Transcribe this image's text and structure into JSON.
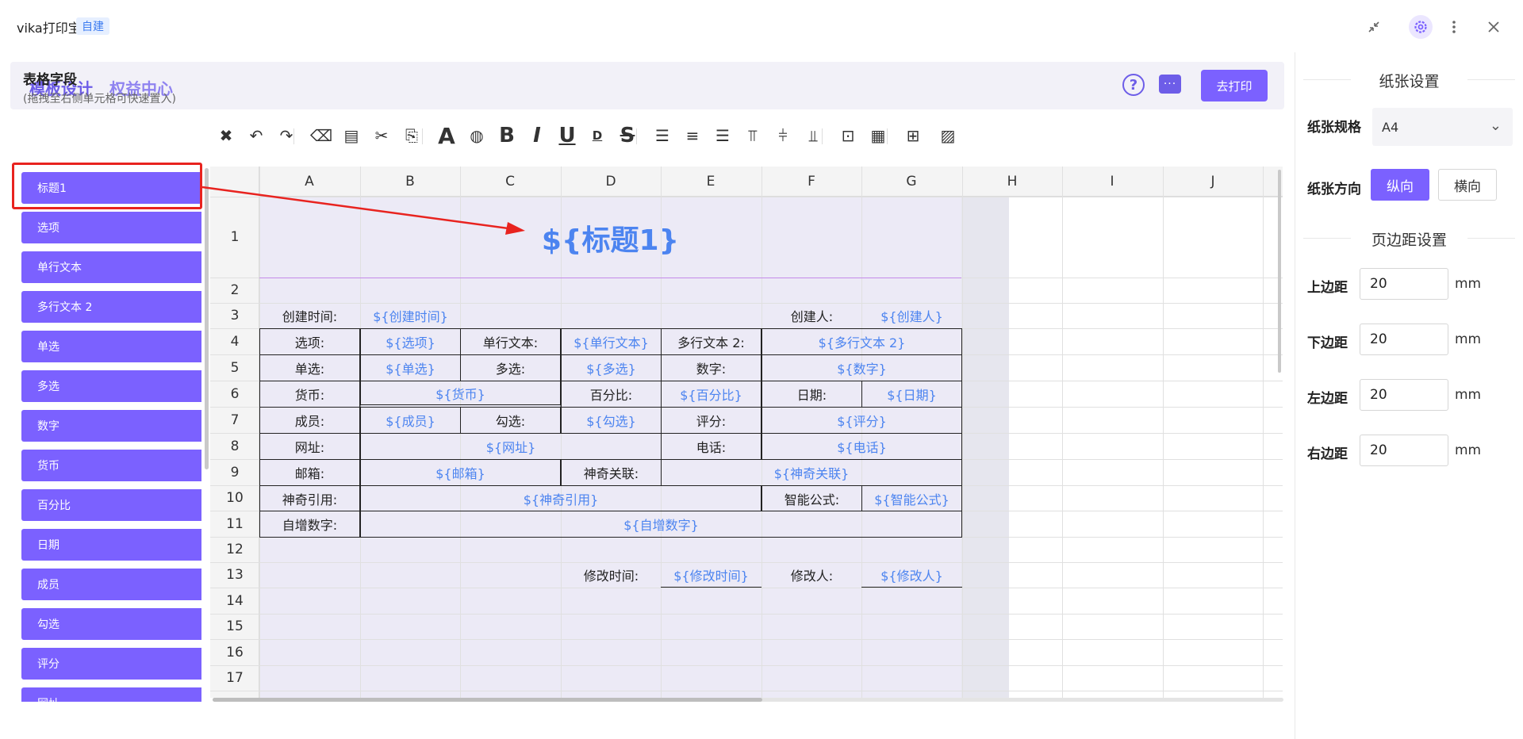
{
  "window": {
    "app_name": "vika打印宝",
    "app_badge": "自建"
  },
  "topnav": {
    "tab_design": "模板设计",
    "tab_rights": "权益中心",
    "help_glyph": "?",
    "chat_glyph": "···",
    "print_button": "去打印"
  },
  "fields": {
    "title": "表格字段",
    "hint": "(拖拽至右侧单元格可快速置入)",
    "items": [
      "标题1",
      "选项",
      "单行文本",
      "多行文本 2",
      "单选",
      "多选",
      "数字",
      "货币",
      "百分比",
      "日期",
      "成员",
      "勾选",
      "评分",
      "网址"
    ]
  },
  "toolbar": {
    "icons": [
      "delete-icon",
      "undo-icon",
      "redo-icon",
      "eraser-icon",
      "format-painter-icon",
      "scissors-icon",
      "paste-icon",
      "font-icon",
      "color-palette-icon",
      "bold-icon",
      "italic-icon",
      "underline-icon",
      "border-bottom-text-icon",
      "strikethrough-icon",
      "align-left-icon",
      "align-center-icon",
      "align-right-icon",
      "valign-top-icon",
      "valign-middle-icon",
      "valign-bottom-icon",
      "insert-field-icon",
      "table-border-icon",
      "merge-cells-icon",
      "insert-image-icon"
    ],
    "glyphs": {
      "font": "A",
      "bold": "B",
      "italic": "I",
      "underline": "U",
      "border_text": "D",
      "strike": "S"
    }
  },
  "sheet": {
    "columns": [
      "A",
      "B",
      "C",
      "D",
      "E",
      "F",
      "G",
      "H",
      "I",
      "J"
    ],
    "rows": [
      "1",
      "2",
      "3",
      "4",
      "5",
      "6",
      "7",
      "8",
      "9",
      "10",
      "11",
      "12",
      "13",
      "14",
      "15",
      "16",
      "17"
    ],
    "title_placeholder": "${标题1}",
    "cells": {
      "r3_label_created_time": "创建时间:",
      "r3_created_time": "${创建时间}",
      "r3_label_creator": "创建人:",
      "r3_creator": "${创建人}",
      "r4_label_option": "选项:",
      "r4_option": "${选项}",
      "r4_label_single_text": "单行文本:",
      "r4_single_text": "${单行文本}",
      "r4_label_multi_text": "多行文本 2:",
      "r4_multi_text": "${多行文本 2}",
      "r5_label_single_select": "单选:",
      "r5_single_select": "${单选}",
      "r5_label_multi_select": "多选:",
      "r5_multi_select": "${多选}",
      "r5_label_number": "数字:",
      "r5_number": "${数字}",
      "r6_label_currency": "货币:",
      "r6_currency": "${货币}",
      "r6_label_percent": "百分比:",
      "r6_percent": "${百分比}",
      "r6_label_date": "日期:",
      "r6_date": "${日期}",
      "r7_label_member": "成员:",
      "r7_member": "${成员}",
      "r7_label_checkbox": "勾选:",
      "r7_checkbox": "${勾选}",
      "r7_label_rating": "评分:",
      "r7_rating": "${评分}",
      "r8_label_url": "网址:",
      "r8_url": "${网址}",
      "r8_label_phone": "电话:",
      "r8_phone": "${电话}",
      "r9_label_email": "邮箱:",
      "r9_email": "${邮箱}",
      "r9_label_magic_link": "神奇关联:",
      "r9_magic_link": "${神奇关联}",
      "r10_label_magic_ref": "神奇引用:",
      "r10_magic_ref": "${神奇引用}",
      "r10_label_formula": "智能公式:",
      "r10_formula": "${智能公式}",
      "r11_label_autonumber": "自增数字:",
      "r11_autonumber": "${自增数字}",
      "r13_label_modified_time": "修改时间:",
      "r13_modified_time": "${修改时间}",
      "r13_label_modifier": "修改人:",
      "r13_modifier": "${修改人}"
    }
  },
  "settings": {
    "paper_title": "纸张设置",
    "paper_size_label": "纸张规格",
    "paper_size_value": "A4",
    "orientation_label": "纸张方向",
    "orientation_portrait": "纵向",
    "orientation_landscape": "横向",
    "margin_title": "页边距设置",
    "margins": [
      {
        "label": "上边距",
        "value": "20",
        "unit": "mm"
      },
      {
        "label": "下边距",
        "value": "20",
        "unit": "mm"
      },
      {
        "label": "左边距",
        "value": "20",
        "unit": "mm"
      },
      {
        "label": "右边距",
        "value": "20",
        "unit": "mm"
      }
    ]
  },
  "colors": {
    "accent": "#7b61ff",
    "template_text": "#4c84f0",
    "annotation": "#e8231f"
  }
}
